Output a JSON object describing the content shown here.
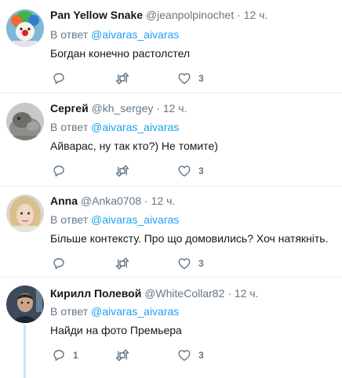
{
  "tweets": [
    {
      "name": "Pan Yellow Snake",
      "handle": "@jeanpolpinochet",
      "dot": "·",
      "time": "12 ч.",
      "reply_prefix": "В ответ",
      "reply_to": "@aivaras_aivaras",
      "text": "Богдан конечно растолстел",
      "reply_count": "",
      "retweet_count": "",
      "like_count": "3"
    },
    {
      "name": "Сергей",
      "handle": "@kh_sergey",
      "dot": "·",
      "time": "12 ч.",
      "reply_prefix": "В ответ",
      "reply_to": "@aivaras_aivaras",
      "text": "Айварас, ну так кто?) Не томите)",
      "reply_count": "",
      "retweet_count": "",
      "like_count": "3"
    },
    {
      "name": "Anna",
      "handle": "@Anka0708",
      "dot": "·",
      "time": "12 ч.",
      "reply_prefix": "В ответ",
      "reply_to": "@aivaras_aivaras",
      "text": "Більше контексту. Про що домовились?  Хоч натякніть.",
      "reply_count": "",
      "retweet_count": "",
      "like_count": "3"
    },
    {
      "name": "Кирилл Полевой",
      "handle": "@WhiteCollar82",
      "dot": "·",
      "time": "12 ч.",
      "reply_prefix": "В ответ",
      "reply_to": "@aivaras_aivaras",
      "text": "Найди на фото Премьера",
      "reply_count": "1",
      "retweet_count": "",
      "like_count": "3"
    }
  ],
  "icons": {
    "reply": "reply-icon",
    "retweet": "retweet-icon",
    "like": "heart-icon"
  },
  "colors": {
    "link": "#1da1f2",
    "secondary_text": "#657786",
    "divider": "#e6ecf0",
    "thread_line": "#c4e6fb"
  }
}
